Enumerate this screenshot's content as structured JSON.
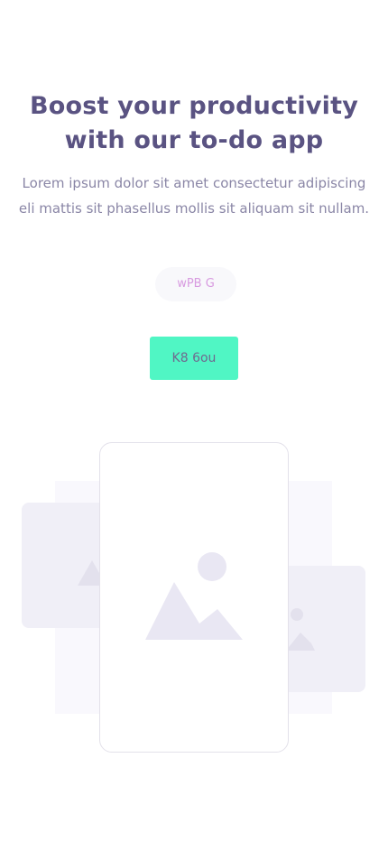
{
  "hero": {
    "title_line1": "Boost your productivity",
    "title_line2": "with our to-do app",
    "description_line1": "Lorem ipsum dolor sit amet consectetur adipiscing",
    "description_line2": "eli mattis sit phasellus mollis sit aliquam sit nullam."
  },
  "tag": {
    "label": "wPB G"
  },
  "cta": {
    "label": "K8 6ou"
  },
  "colors": {
    "title": "#5a5382",
    "description": "#8a86a6",
    "cta_background": "#50f6c4",
    "placeholder_card": "#f0eff7",
    "placeholder_icon": "#e6e4f0",
    "tag_text": "#d89be0"
  },
  "icons": {
    "main_image": "image-placeholder-icon",
    "left_image": "image-placeholder-icon",
    "right_image": "image-placeholder-icon"
  }
}
